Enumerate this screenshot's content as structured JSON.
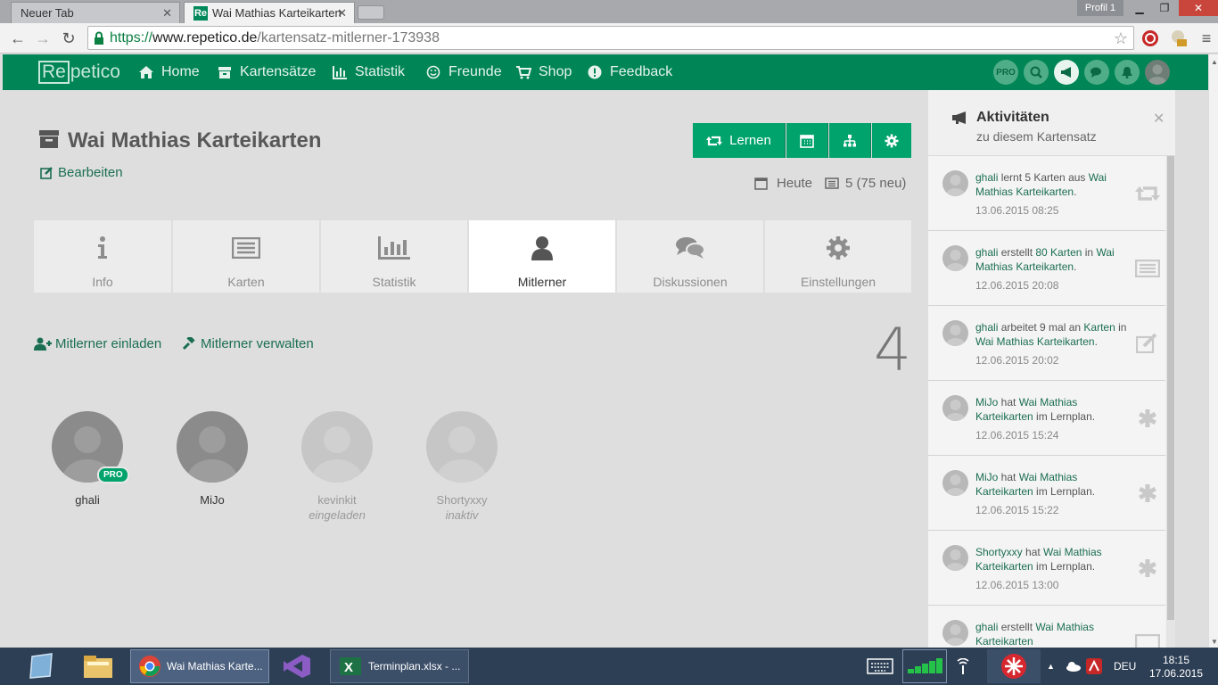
{
  "browser": {
    "tabs": [
      {
        "title": "Neuer Tab"
      },
      {
        "title": "Wai Mathias Karteikarten",
        "favicon": "Re"
      }
    ],
    "profile": "Profil 1",
    "url_scheme": "https://",
    "url_host": "www.repetico.de",
    "url_path": "/kartensatz-mitlerner-173938"
  },
  "site": {
    "logo": {
      "part1": "Re",
      "part2": "petico"
    },
    "nav": [
      {
        "label": "Home",
        "icon": "home-icon"
      },
      {
        "label": "Kartensätze",
        "icon": "archive-icon"
      },
      {
        "label": "Statistik",
        "icon": "bar-chart-icon"
      },
      {
        "label": "Freunde",
        "icon": "smile-icon"
      },
      {
        "label": "Shop",
        "icon": "cart-icon"
      },
      {
        "label": "Feedback",
        "icon": "exclamation-icon"
      }
    ],
    "pro_badge": "PRO"
  },
  "cardset": {
    "title": "Wai Mathias Karteikarten",
    "edit_label": "Bearbeiten",
    "learn_label": "Lernen",
    "today_label": "Heute",
    "cards_due": "5 (75 neu)"
  },
  "tabs": [
    {
      "label": "Info",
      "icon": "info-icon"
    },
    {
      "label": "Karten",
      "icon": "cards-icon"
    },
    {
      "label": "Statistik",
      "icon": "bar-chart-icon"
    },
    {
      "label": "Mitlerner",
      "icon": "user-icon",
      "active": true
    },
    {
      "label": "Diskussionen",
      "icon": "comments-icon"
    },
    {
      "label": "Einstellungen",
      "icon": "gear-icon"
    }
  ],
  "colearners": {
    "invite_label": "Mitlerner einladen",
    "manage_label": "Mitlerner verwalten",
    "count": "4",
    "members": [
      {
        "name": "ghali",
        "status": "",
        "pro": "PRO"
      },
      {
        "name": "MiJo",
        "status": ""
      },
      {
        "name": "kevinkit",
        "status": "eingeladen"
      },
      {
        "name": "Shortyxxy",
        "status": "inaktiv"
      }
    ]
  },
  "activities": {
    "title": "Aktivitäten",
    "subtitle": "zu diesem Kartensatz",
    "items": [
      {
        "user": "ghali",
        "text": " lernt 5 Karten aus ",
        "link": "Wai Mathias Karteikarten",
        "rest": ".",
        "time": "13.06.2015 08:25",
        "icon": "retweet-icon"
      },
      {
        "user": "ghali",
        "text": " erstellt ",
        "link2": "80 Karten",
        "mid": " in ",
        "link": "Wai Mathias Karteikarten",
        "rest": ".",
        "time": "12.06.2015 20:08",
        "icon": "cards-icon"
      },
      {
        "user": "ghali",
        "text": " arbeitet 9 mal an ",
        "link2": "Karten",
        "mid": " in ",
        "link": "Wai Mathias Karteikarten",
        "rest": ".",
        "time": "12.06.2015 20:02",
        "icon": "edit-icon"
      },
      {
        "user": "MiJo",
        "text": " hat ",
        "link": "Wai Mathias Karteikarten",
        "rest": " im Lernplan.",
        "time": "12.06.2015 15:24",
        "icon": "asterisk-icon"
      },
      {
        "user": "MiJo",
        "text": " hat ",
        "link": "Wai Mathias Karteikarten",
        "rest": " im Lernplan.",
        "time": "12.06.2015 15:22",
        "icon": "asterisk-icon"
      },
      {
        "user": "Shortyxxy",
        "text": " hat ",
        "link": "Wai Mathias Karteikarten",
        "rest": " im Lernplan.",
        "time": "12.06.2015 13:00",
        "icon": "asterisk-icon"
      },
      {
        "user": "ghali",
        "text": " erstellt ",
        "link": "Wai Mathias Karteikarten",
        "rest": "",
        "time": "",
        "icon": "cards-icon"
      }
    ]
  },
  "taskbar": {
    "items": [
      {
        "label": "Wai Mathias Karte..."
      },
      {
        "label": "Terminplan.xlsx - ..."
      }
    ],
    "lang": "DEU",
    "time": "18:15",
    "date": "17.06.2015"
  },
  "colors": {
    "brand": "#008557",
    "button": "#00a36c",
    "link": "#1b6e52"
  }
}
